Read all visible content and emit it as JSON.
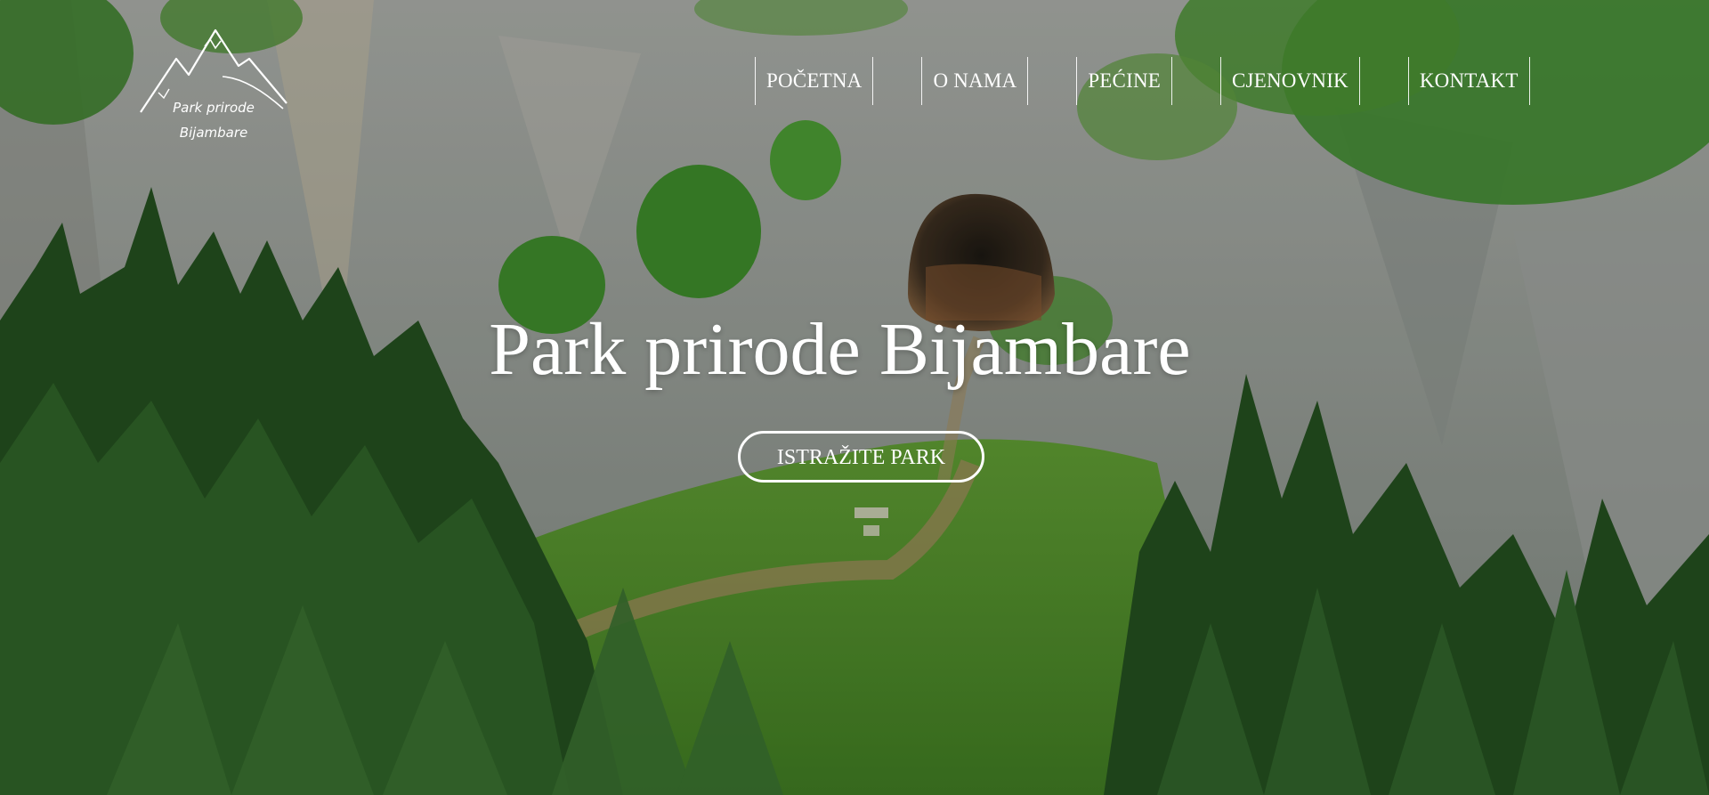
{
  "logo": {
    "line1": "Park prirode",
    "line2": "Bijambare"
  },
  "nav": {
    "items": [
      {
        "label": "POČETNA"
      },
      {
        "label": "O NAMA"
      },
      {
        "label": "PEĆINE"
      },
      {
        "label": "CJENOVNIK"
      },
      {
        "label": "KONTAKT"
      }
    ]
  },
  "hero": {
    "title": "Park prirode Bijambare",
    "cta_label": "ISTRAŽITE PARK"
  },
  "colors": {
    "text": "#ffffff",
    "forest": "#2f5a25",
    "grass": "#6ea83a",
    "rock": "#9a9f9c"
  }
}
